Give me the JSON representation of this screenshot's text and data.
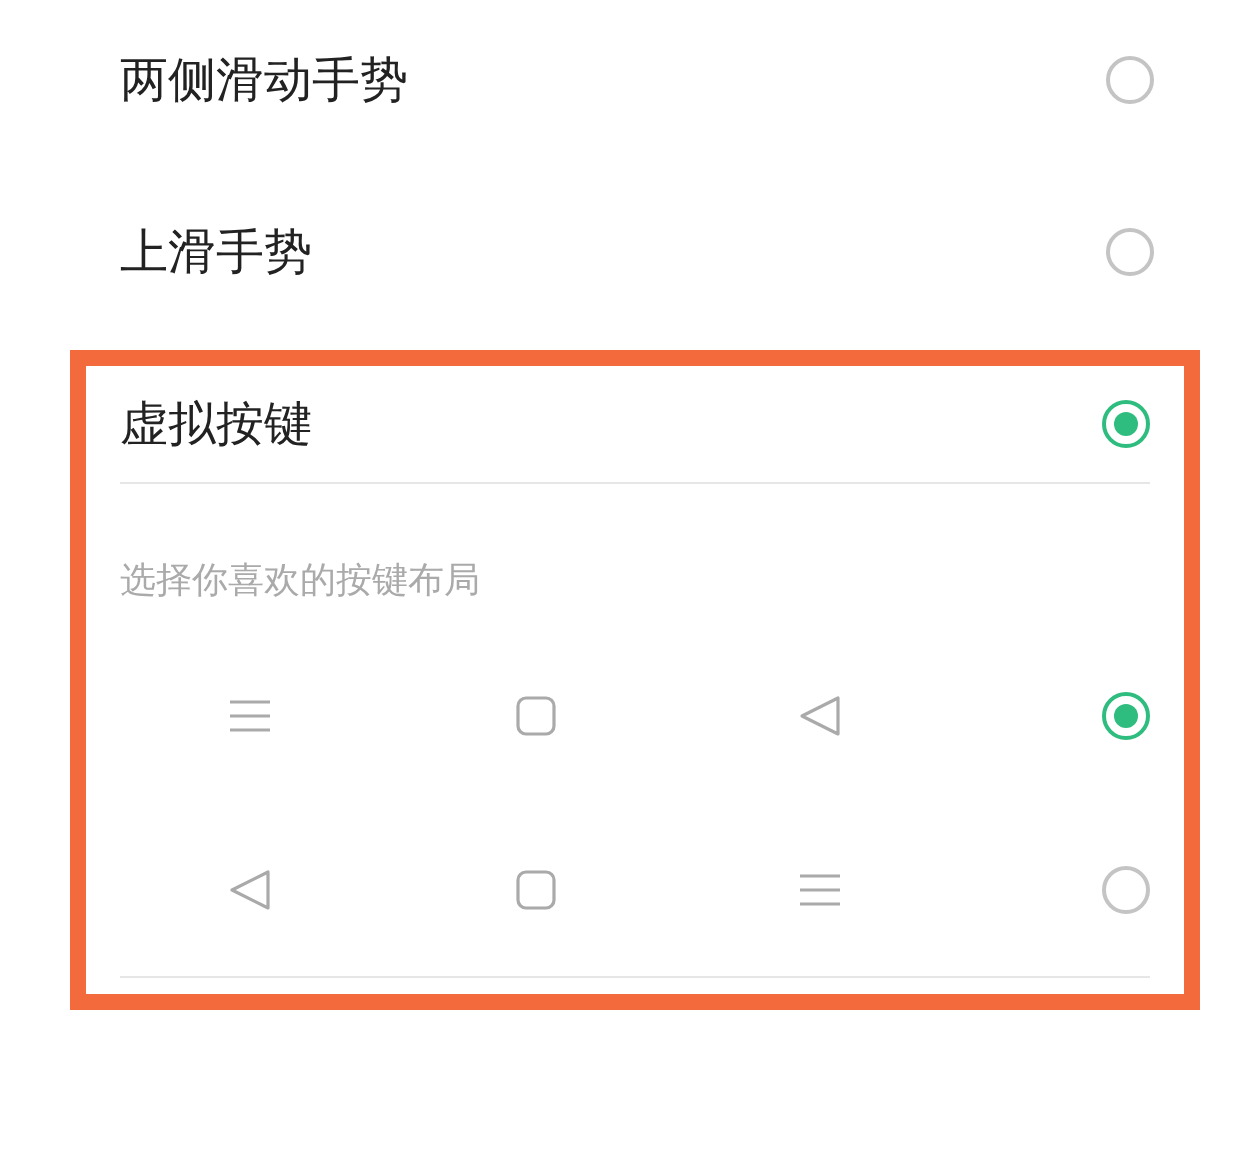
{
  "options": [
    {
      "label": "两侧滑动手势",
      "selected": false,
      "highlighted": false
    },
    {
      "label": "上滑手势",
      "selected": false,
      "highlighted": false
    },
    {
      "label": "虚拟按键",
      "selected": true,
      "highlighted": true,
      "hint": "选择你喜欢的按键布局",
      "layouts": [
        {
          "selected": true,
          "keys": [
            {
              "kind": "menu"
            },
            {
              "kind": "home"
            },
            {
              "kind": "back"
            }
          ]
        },
        {
          "selected": false,
          "keys": [
            {
              "kind": "back"
            },
            {
              "kind": "home"
            },
            {
              "kind": "menu"
            }
          ]
        }
      ]
    }
  ]
}
